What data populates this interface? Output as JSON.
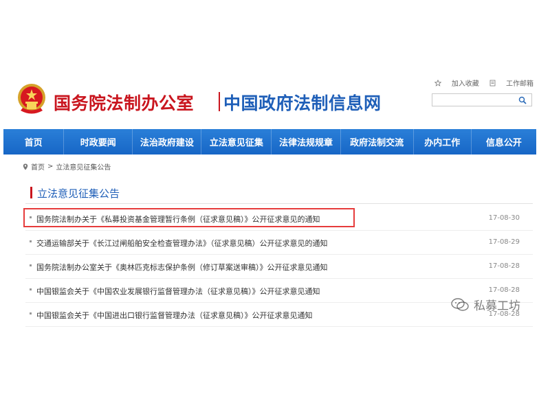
{
  "header": {
    "site_title_gov": "国务院法制办公室",
    "site_title_net": "中国政府法制信息网",
    "top_links": {
      "favorite": "加入收藏",
      "email": "工作邮箱"
    },
    "search": {
      "placeholder": ""
    }
  },
  "nav": {
    "items": [
      {
        "label": "首页"
      },
      {
        "label": "时政要闻"
      },
      {
        "label": "法治政府建设"
      },
      {
        "label": "立法意见征集"
      },
      {
        "label": "法律法规规章"
      },
      {
        "label": "政府法制交流"
      },
      {
        "label": "办内工作"
      },
      {
        "label": "信息公开"
      }
    ]
  },
  "breadcrumb": {
    "home": "首页",
    "separator": ">",
    "current": "立法意见征集公告"
  },
  "section": {
    "title": "立法意见征集公告"
  },
  "notices": [
    {
      "title": "国务院法制办关于《私募投资基金管理暂行条例（征求意见稿）》公开征求意见的通知",
      "date": "17-08-30"
    },
    {
      "title": "交通运输部关于《长江过闸船舶安全检查管理办法》（征求意见稿）公开征求意见的通知",
      "date": "17-08-29"
    },
    {
      "title": "国务院法制办公室关于《奥林匹克标志保护条例（修订草案送审稿）》公开征求意见通知",
      "date": "17-08-28"
    },
    {
      "title": "中国银监会关于《中国农业发展银行监督管理办法（征求意见稿）》公开征求意见通知",
      "date": "17-08-28"
    },
    {
      "title": "中国银监会关于《中国进出口银行监督管理办法（征求意见稿）》公开征求意见通知",
      "date": "17-08-28"
    }
  ],
  "watermark": {
    "text": "私募工坊"
  },
  "colors": {
    "nav_blue": "#1f6fd0",
    "title_red": "#c9151e",
    "title_blue": "#1f5fb8",
    "highlight_red": "#e63b3b"
  },
  "icons": {
    "emblem": "national-emblem-icon",
    "favorite": "star-icon",
    "email": "document-icon",
    "search": "search-icon",
    "breadcrumb": "location-pin-icon",
    "watermark": "wechat-icon"
  }
}
